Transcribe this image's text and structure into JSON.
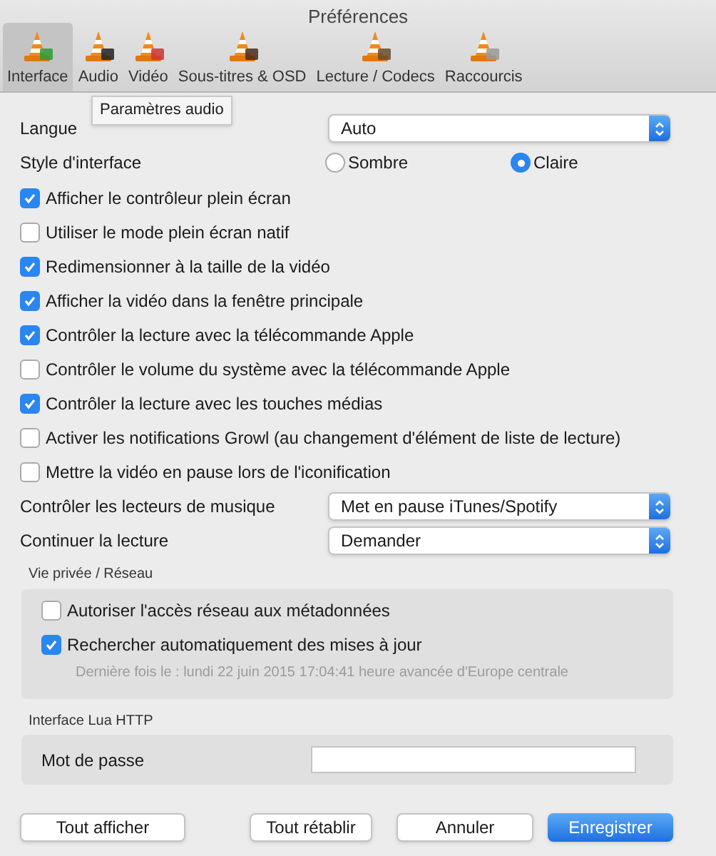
{
  "window": {
    "title": "Préférences"
  },
  "tabs": [
    {
      "label": "Interface",
      "selected": true
    },
    {
      "label": "Audio",
      "selected": false
    },
    {
      "label": "Vidéo",
      "selected": false
    },
    {
      "label": "Sous-titres & OSD",
      "selected": false
    },
    {
      "label": "Lecture / Codecs",
      "selected": false
    },
    {
      "label": "Raccourcis",
      "selected": false
    }
  ],
  "tooltip": "Paramètres audio",
  "language": {
    "label": "Langue",
    "value": "Auto"
  },
  "style": {
    "label": "Style d'interface",
    "options": [
      {
        "label": "Sombre",
        "selected": false
      },
      {
        "label": "Claire",
        "selected": true
      }
    ]
  },
  "options": [
    {
      "label": "Afficher le contrôleur plein écran",
      "checked": true
    },
    {
      "label": "Utiliser le mode plein écran natif",
      "checked": false
    },
    {
      "label": "Redimensionner à la taille de la vidéo",
      "checked": true
    },
    {
      "label": "Afficher la vidéo dans la fenêtre principale",
      "checked": true
    },
    {
      "label": "Contrôler la lecture avec la télécommande Apple",
      "checked": true
    },
    {
      "label": "Contrôler le volume du système avec la télécommande Apple",
      "checked": false
    },
    {
      "label": "Contrôler la lecture avec les touches médias",
      "checked": true
    },
    {
      "label": "Activer les notifications Growl (au changement d'élément de liste de lecture)",
      "checked": false
    },
    {
      "label": "Mettre la vidéo en pause lors de l'iconification",
      "checked": false
    }
  ],
  "selects": [
    {
      "label": "Contrôler les lecteurs de musique",
      "value": "Met en pause iTunes/Spotify"
    },
    {
      "label": "Continuer la lecture",
      "value": "Demander"
    }
  ],
  "privacy": {
    "title": "Vie privée / Réseau",
    "options": [
      {
        "label": "Autoriser l'accès réseau aux métadonnées",
        "checked": false
      },
      {
        "label": "Rechercher automatiquement des mises à jour",
        "checked": true
      }
    ],
    "note": "Dernière fois le : lundi 22 juin 2015 17:04:41 heure avancée d'Europe centrale"
  },
  "lua": {
    "title": "Interface Lua HTTP",
    "label": "Mot de passe"
  },
  "buttons": [
    {
      "label": "Tout afficher",
      "primary": false
    },
    {
      "label": "Tout rétablir",
      "primary": false
    },
    {
      "label": "Annuler",
      "primary": false
    },
    {
      "label": "Enregistrer",
      "primary": true
    }
  ]
}
